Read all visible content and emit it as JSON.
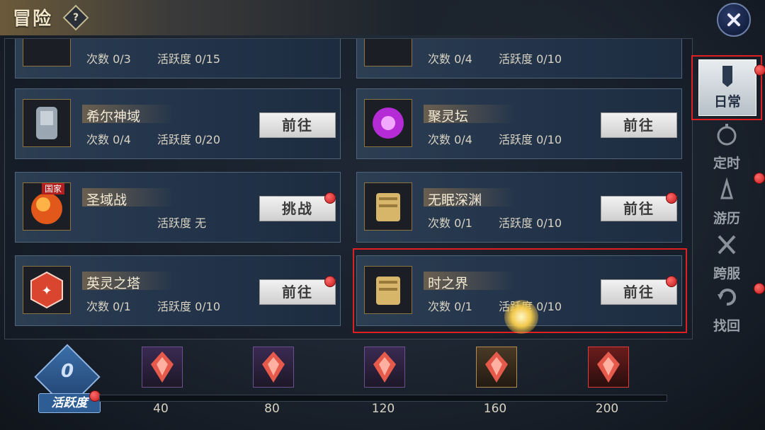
{
  "header": {
    "title": "冒险",
    "help_icon": "?"
  },
  "cards": [
    {
      "name": "",
      "count": "次数 0/3",
      "activity": "活跃度 0/15",
      "button": "",
      "badge": false
    },
    {
      "name": "",
      "count": "次数 0/4",
      "activity": "活跃度 0/10",
      "button": "",
      "badge": false
    },
    {
      "name": "希尔神域",
      "count": "次数 0/4",
      "activity": "活跃度 0/20",
      "button": "前往",
      "badge": false
    },
    {
      "name": "聚灵坛",
      "count": "次数 0/4",
      "activity": "活跃度 0/10",
      "button": "前往",
      "badge": false
    },
    {
      "name": "圣域战",
      "count": "",
      "activity": "活跃度 无",
      "button": "挑战",
      "badge": true,
      "tag": "国家"
    },
    {
      "name": "无眠深渊",
      "count": "次数 0/1",
      "activity": "活跃度 0/10",
      "button": "前往",
      "badge": true
    },
    {
      "name": "英灵之塔",
      "count": "次数 0/1",
      "activity": "活跃度 0/10",
      "button": "前往",
      "badge": true
    },
    {
      "name": "时之界",
      "count": "次数 0/1",
      "activity": "活跃度 0/10",
      "button": "前往",
      "badge": true
    }
  ],
  "sidebar": [
    {
      "label": "日常",
      "icon": "banner-icon",
      "active": true,
      "badge": true
    },
    {
      "label": "定时",
      "icon": "stopwatch-icon",
      "active": false,
      "badge": false
    },
    {
      "label": "游历",
      "icon": "travel-icon",
      "active": false,
      "badge": true
    },
    {
      "label": "跨服",
      "icon": "crossed-swords-icon",
      "active": false,
      "badge": false
    },
    {
      "label": "找回",
      "icon": "recover-icon",
      "active": false,
      "badge": true
    }
  ],
  "activity_bar": {
    "score": "0",
    "label": "活跃度",
    "progress": 0,
    "milestones": [
      "40",
      "80",
      "120",
      "160",
      "200"
    ]
  },
  "colors": {
    "badge": "#d42020",
    "highlight": "#e02020",
    "button": "#e4e4e4"
  }
}
